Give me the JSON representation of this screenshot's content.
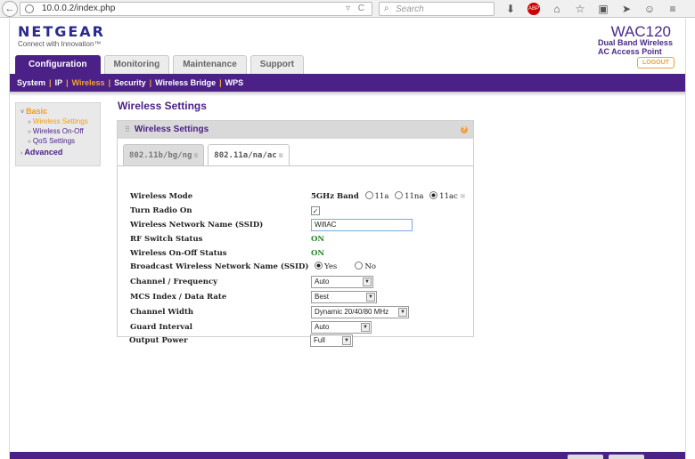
{
  "browser": {
    "back_icon": "back-arrow-icon",
    "url": "10.0.0.2/index.php",
    "url_icons": "▿ C",
    "search_placeholder": "Search",
    "search_icon": "🔍",
    "toolbar_icons": [
      "⬇",
      "ABP",
      "⌂",
      "☆",
      "▣",
      "➤",
      "☺",
      "≡"
    ]
  },
  "header": {
    "logo": "NETGEAR",
    "tagline": "Connect with Innovation™",
    "product": "WAC120",
    "product_line1": "Dual Band Wireless",
    "product_line2": "AC Access Point",
    "logout": "LOGOUT"
  },
  "tabs": [
    {
      "label": "Configuration",
      "active": true
    },
    {
      "label": "Monitoring",
      "active": false
    },
    {
      "label": "Maintenance",
      "active": false
    },
    {
      "label": "Support",
      "active": false
    }
  ],
  "subnav": {
    "system": "System",
    "ip": "IP",
    "wireless": "Wireless",
    "security": "Security",
    "bridge": "Wireless Bridge",
    "wps": "WPS",
    "sep": "|"
  },
  "sidebar": {
    "basic": "Basic",
    "items": [
      "Wireless Settings",
      "Wireless On-Off",
      "QoS Settings"
    ],
    "advanced": "Advanced"
  },
  "main": {
    "title": "Wireless Settings",
    "panel_title": "Wireless Settings",
    "band_tabs": [
      "802.11b/bg/ng",
      "802.11a/na/ac"
    ]
  },
  "form": {
    "wireless_mode": {
      "label": "Wireless Mode",
      "band": "5GHz Band",
      "options": [
        "11a",
        "11na",
        "11ac"
      ],
      "selected": "11ac"
    },
    "turn_radio_on": {
      "label": "Turn Radio On",
      "check": "✓"
    },
    "ssid": {
      "label": "Wireless Network Name (SSID)",
      "value": "WifiAC"
    },
    "rf_switch": {
      "label": "RF Switch Status",
      "value": "ON"
    },
    "onoff_status": {
      "label": "Wireless On-Off Status",
      "value": "ON"
    },
    "broadcast": {
      "label": "Broadcast Wireless Network Name (SSID)",
      "yes": "Yes",
      "no": "No",
      "selected": "Yes"
    },
    "channel": {
      "label": "Channel / Frequency",
      "value": "Auto"
    },
    "mcs": {
      "label": "MCS Index / Data Rate",
      "value": "Best"
    },
    "width": {
      "label": "Channel Width",
      "value": "Dynamic 20/40/80 MHz"
    },
    "guard": {
      "label": "Guard Interval",
      "value": "Auto"
    },
    "power": {
      "label": "Output Power",
      "value": "Full"
    }
  },
  "colors": {
    "brand_purple": "#4b2188",
    "accent_orange": "#f39c12",
    "status_green": "#2a8a2a"
  }
}
